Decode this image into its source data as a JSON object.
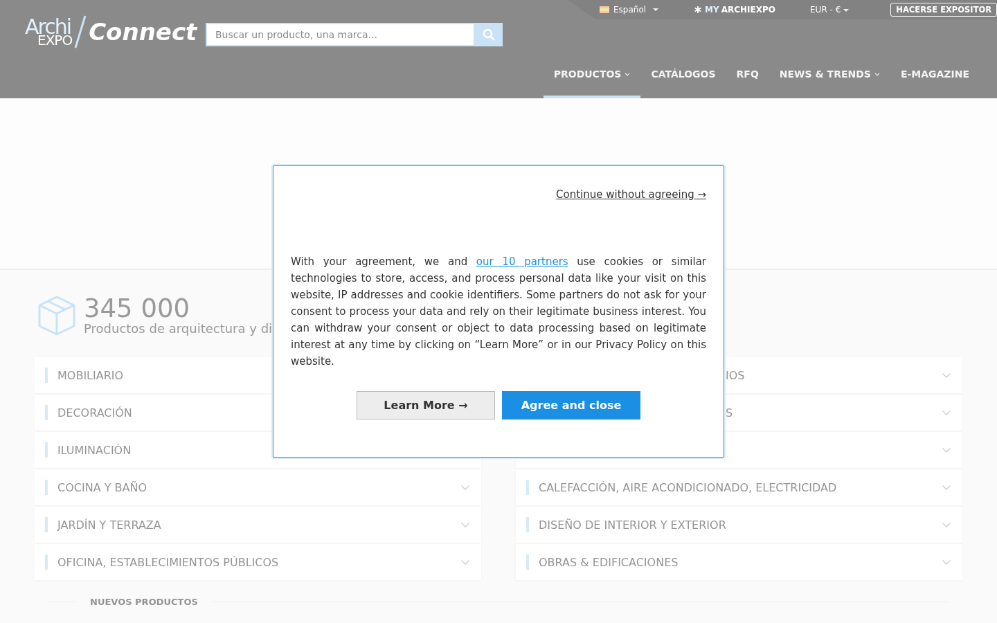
{
  "header": {
    "logo": {
      "part_1": "Archi",
      "part_2": "EXPO",
      "part_3": "Connect"
    },
    "top_bar": {
      "language": "Español",
      "account_prefix": "MY",
      "account": "ARCHIEXPO",
      "currency": "EUR - €",
      "exhibitor_button": "HACERSE EXPOSITOR"
    },
    "search": {
      "placeholder": "Buscar un producto, una marca..."
    },
    "nav": [
      {
        "label": "PRODUCTOS",
        "dropdown": true,
        "selected": true
      },
      {
        "label": "CATÁLOGOS",
        "dropdown": false,
        "selected": false
      },
      {
        "label": "RFQ",
        "dropdown": false,
        "selected": false
      },
      {
        "label": "NEWS & TRENDS",
        "dropdown": true,
        "selected": false
      },
      {
        "label": "E-MAGAZINE",
        "dropdown": false,
        "selected": false
      }
    ]
  },
  "stats": {
    "count": "345 000",
    "caption": "Productos de arquitectura y di"
  },
  "categories": {
    "left": [
      {
        "label": "MOBILIARIO"
      },
      {
        "label": "DECORACIÓN"
      },
      {
        "label": "ILUMINACIÓN"
      },
      {
        "label": "COCINA Y BAÑO",
        "chevron": true
      },
      {
        "label": "JARDÍN Y TERRAZA",
        "chevron": true
      },
      {
        "label": "OFICINA, ESTABLECIMIENTOS PÚBLICOS",
        "chevron": true
      }
    ],
    "right": [
      {
        "label": "IOS",
        "covered": true,
        "chevron": true
      },
      {
        "label": "S",
        "covered": true,
        "chevron": true
      },
      {
        "covered": true,
        "chevron": true
      },
      {
        "label": "CALEFACCIÓN, AIRE ACONDICIONADO, ELECTRICIDAD",
        "covered": false,
        "chevron": true
      },
      {
        "label": "DISEÑO DE INTERIOR Y EXTERIOR",
        "covered": false,
        "chevron": true
      },
      {
        "label": "OBRAS & EDIFICACIONES",
        "covered": false,
        "chevron": true
      }
    ]
  },
  "section_title": "NUEVOS PRODUCTOS",
  "cookie_dialog": {
    "skip_link": "Continue without agreeing →",
    "text_before": "With your agreement, we and ",
    "partners_link": "our 10 partners",
    "text_after": " use cookies or similar technologies to store, access, and process personal data like your visit on this website, IP addresses and cookie identifiers. Some partners do not ask for your consent to process your data and rely on their legitimate business interest. You can withdraw your consent or object to data processing based on legitimate interest at any time by clicking on “Learn More” or in our Privacy Policy on this website.",
    "buttons": [
      {
        "label": "Learn More →",
        "kind": "secondary"
      },
      {
        "label": "Agree and close",
        "kind": "primary"
      }
    ]
  }
}
